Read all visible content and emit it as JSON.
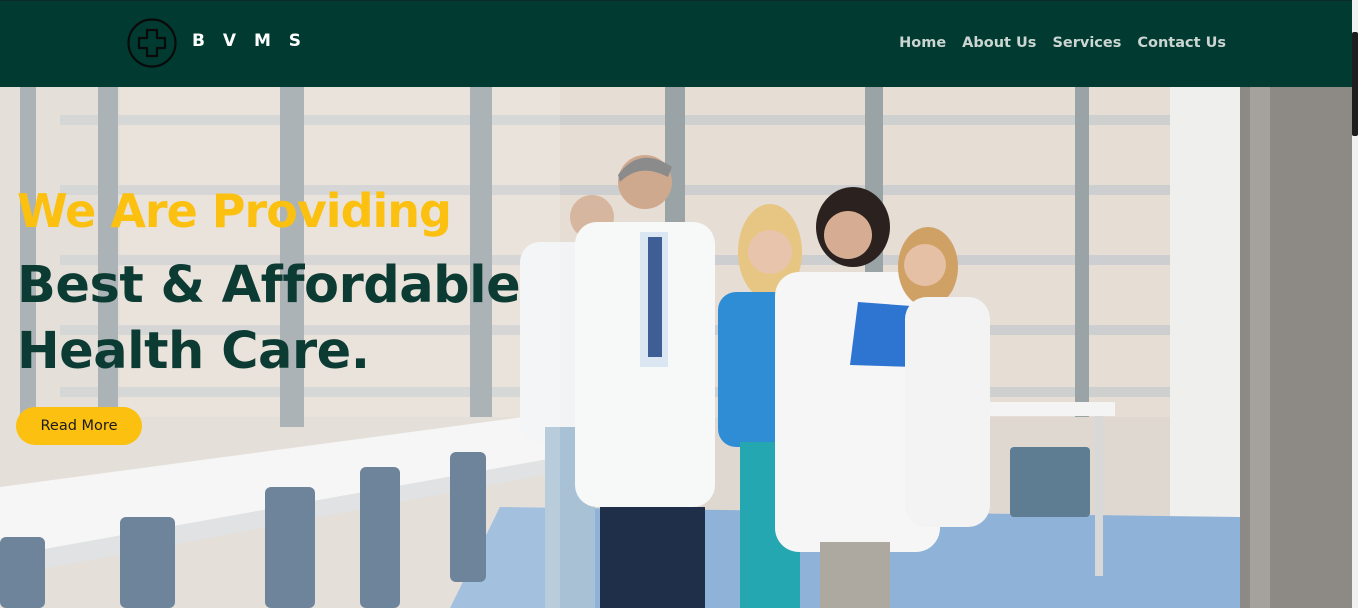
{
  "brand": {
    "name": "B V M S",
    "logo_icon": "medical-cross-icon"
  },
  "nav": {
    "items": [
      {
        "label": "Home"
      },
      {
        "label": "About Us"
      },
      {
        "label": "Services"
      },
      {
        "label": "Contact Us"
      }
    ]
  },
  "hero": {
    "kicker": "We Are Providing",
    "headline_line1": "Best & Affordable",
    "headline_line2": "Health Care.",
    "cta_label": "Read More",
    "image_description_icon": "doctors-walking-photo"
  },
  "colors": {
    "navbar_bg": "#013a31",
    "accent_yellow": "#fcc010",
    "headline_dark_green": "#0b3b33",
    "nav_text": "#cbd5d2"
  }
}
